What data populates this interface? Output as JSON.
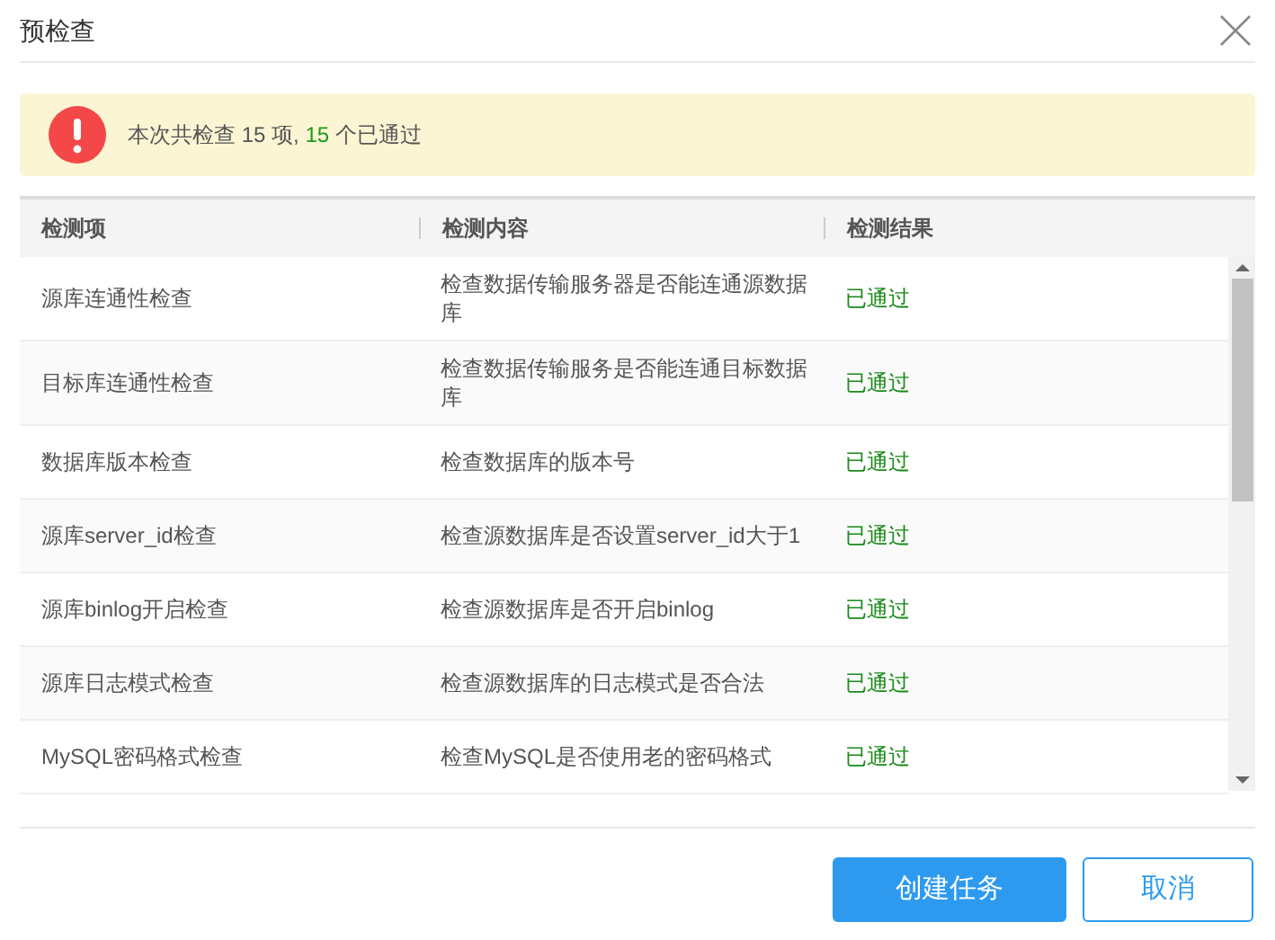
{
  "dialog": {
    "title": "预检查"
  },
  "summary": {
    "prefix": "本次共检查 15 项,",
    "passed": "15",
    "suffix": "个已通过"
  },
  "table": {
    "columns": [
      "检测项",
      "检测内容",
      "检测结果"
    ],
    "rows": [
      {
        "item": "源库连通性检查",
        "content": "检查数据传输服务器是否能连通源数据库",
        "result": "已通过"
      },
      {
        "item": "目标库连通性检查",
        "content": "检查数据传输服务是否能连通目标数据库",
        "result": "已通过"
      },
      {
        "item": "数据库版本检查",
        "content": "检查数据库的版本号",
        "result": "已通过"
      },
      {
        "item": "源库server_id检查",
        "content": "检查源数据库是否设置server_id大于1",
        "result": "已通过"
      },
      {
        "item": "源库binlog开启检查",
        "content": "检查源数据库是否开启binlog",
        "result": "已通过"
      },
      {
        "item": "源库日志模式检查",
        "content": "检查源数据库的日志模式是否合法",
        "result": "已通过"
      },
      {
        "item": "MySQL密码格式检查",
        "content": "检查MySQL是否使用老的密码格式",
        "result": "已通过"
      }
    ]
  },
  "buttons": [
    {
      "label": "创建任务",
      "kind": "primary"
    },
    {
      "label": "取消",
      "kind": "secondary"
    }
  ]
}
